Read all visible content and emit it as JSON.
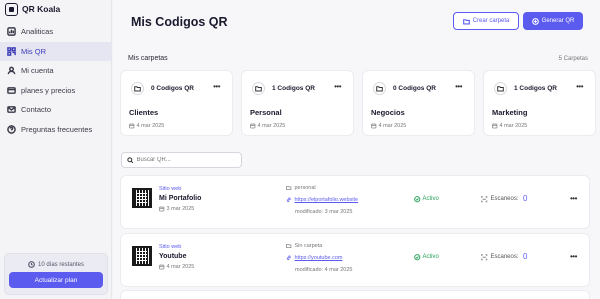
{
  "brand": {
    "name": "QR Koala"
  },
  "sidebar": {
    "items": [
      {
        "label": "Analiticas",
        "icon": "chart-icon"
      },
      {
        "label": "Mis QR",
        "icon": "qr-icon",
        "active": true
      },
      {
        "label": "Mi cuenta",
        "icon": "user-icon"
      },
      {
        "label": "planes y precios",
        "icon": "card-icon"
      },
      {
        "label": "Contacto",
        "icon": "mail-icon"
      },
      {
        "label": "Preguntas frecuentes",
        "icon": "help-icon"
      }
    ],
    "trial_text": "10 días restantes",
    "upgrade_label": "Actualizar plan"
  },
  "header": {
    "title": "Mis Codigos QR",
    "create_folder_label": "Crear carpeta",
    "generate_label": "Generar QR"
  },
  "folders_section": {
    "label": "Mis carpetas",
    "count_text": "5 Carpetas",
    "folders": [
      {
        "count": "0 Codigos QR",
        "name": "Clientes",
        "date": "4 mar 2025"
      },
      {
        "count": "1 Codigos QR",
        "name": "Personal",
        "date": "4 mar 2025"
      },
      {
        "count": "0 Codigos QR",
        "name": "Negocios",
        "date": "4 mar 2025"
      },
      {
        "count": "1 Codigos QR",
        "name": "Marketing",
        "date": "4 mar 2025"
      }
    ]
  },
  "search": {
    "placeholder": "Buscar QR..."
  },
  "qr_list": [
    {
      "type": "Sitio web",
      "name": "Mi Portafolio",
      "date": "3 mar 2025",
      "folder": "personal",
      "url": "https://elportafolio.website",
      "modified": "modificado: 3 mar 2025",
      "status": "Activo",
      "scans_label": "Escaneos:",
      "scans": "0"
    },
    {
      "type": "Sitio web",
      "name": "Youtube",
      "date": "4 mar 2025",
      "folder": "Sin carpeta",
      "url": "https://youtube.com",
      "modified": "modificado: 4 mar 2025",
      "status": "Activo",
      "scans_label": "Escaneos:",
      "scans": "0"
    }
  ],
  "colors": {
    "accent": "#5b5bf0",
    "active_status": "#29a05a"
  }
}
